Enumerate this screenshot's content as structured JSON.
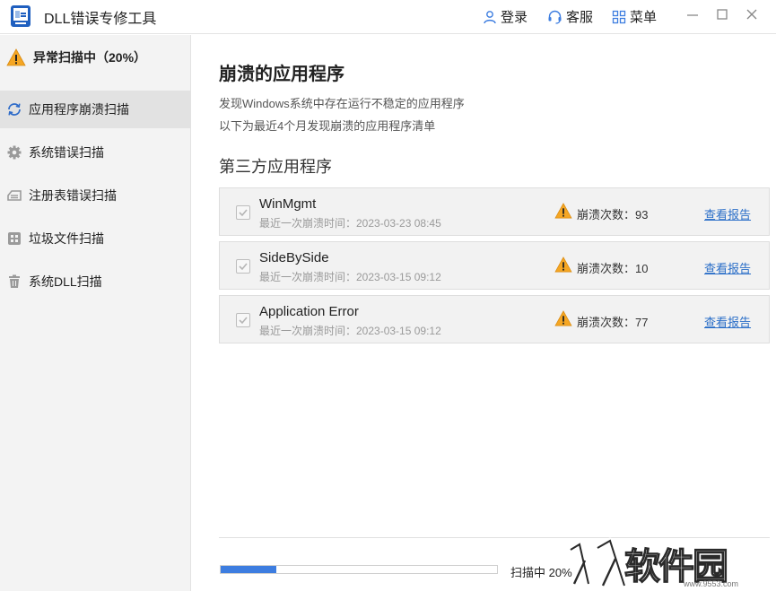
{
  "app": {
    "title": "DLL错误专修工具"
  },
  "header": {
    "login_label": "登录",
    "service_label": "客服",
    "menu_label": "菜单"
  },
  "sidebar": {
    "status_label": "异常扫描中（20%）",
    "items": [
      {
        "label": "应用程序崩溃扫描",
        "icon": "refresh-icon",
        "active": true
      },
      {
        "label": "系统错误扫描",
        "icon": "gear-icon",
        "active": false
      },
      {
        "label": "注册表错误扫描",
        "icon": "registry-icon",
        "active": false
      },
      {
        "label": "垃圾文件扫描",
        "icon": "junk-files-icon",
        "active": false
      },
      {
        "label": "系统DLL扫描",
        "icon": "trash-icon",
        "active": false
      }
    ]
  },
  "main": {
    "title": "崩溃的应用程序",
    "desc1": "发现Windows系统中存在运行不稳定的应用程序",
    "desc2": "以下为最近4个月发现崩溃的应用程序清单",
    "section_title": "第三方应用程序",
    "apps": [
      {
        "name": "WinMgmt",
        "time": "最近一次崩溃时间：2023-03-23 08:45",
        "count": "崩溃次数：93",
        "link": "查看报告",
        "checked": true
      },
      {
        "name": "SideBySide",
        "time": "最近一次崩溃时间：2023-03-15 09:12",
        "count": "崩溃次数：10",
        "link": "查看报告",
        "checked": true
      },
      {
        "name": "Application Error",
        "time": "最近一次崩溃时间：2023-03-15 09:12",
        "count": "崩溃次数：77",
        "link": "查看报告",
        "checked": true
      }
    ]
  },
  "footer": {
    "progress": 0.2,
    "progress_text": "扫描中 20%"
  },
  "watermark": {
    "text": "软件园",
    "domain": "www.9553.com"
  },
  "colors": {
    "accent": "#3d7de0",
    "link": "#2a6ec8",
    "warning": "#f5a623",
    "sidebar_bg": "#f3f3f3",
    "sidebar_active": "#e2e2e2"
  }
}
